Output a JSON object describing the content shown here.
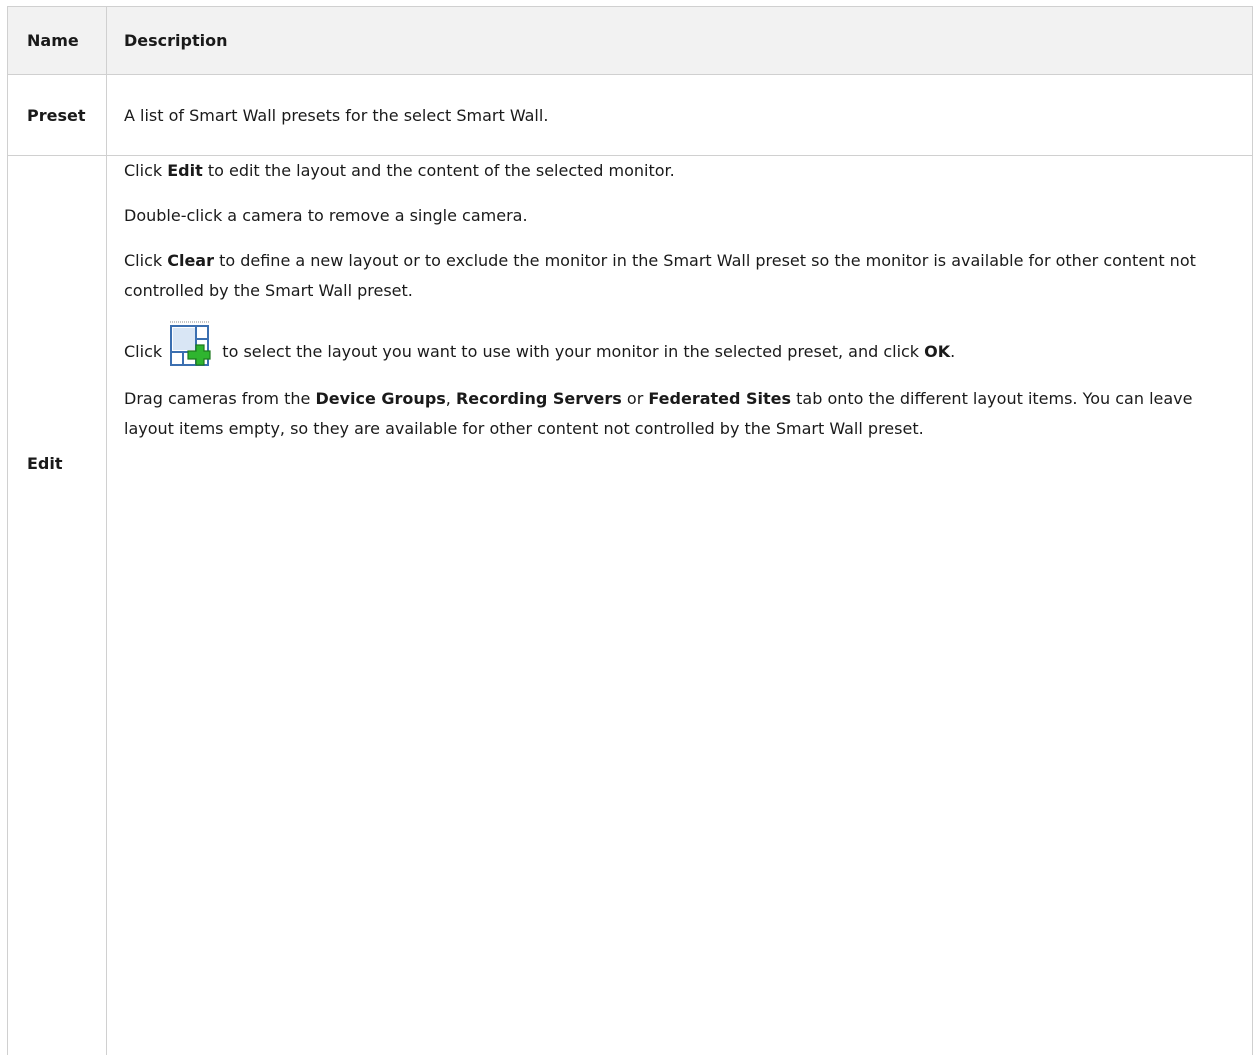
{
  "table": {
    "headers": {
      "name": "Name",
      "description": "Description"
    },
    "rows": {
      "preset": {
        "name": "Preset",
        "description": "A list of Smart Wall presets for the select Smart Wall."
      },
      "edit": {
        "name": "Edit",
        "p1": {
          "a": "Click ",
          "b": "Edit",
          "c": " to edit the layout and the content of the selected monitor."
        },
        "p2": "Double-click a camera to remove a single camera.",
        "p3": {
          "a": "Click ",
          "b": "Clear",
          "c": " to define a new layout or to exclude the monitor in the Smart Wall preset so the monitor is available for other content not controlled by the Smart Wall preset."
        },
        "p4": {
          "a": "Click ",
          "icon": "layout-add-icon",
          "c": " to select the layout you want to use with your monitor in the selected preset, and click ",
          "d": "OK",
          "e": "."
        },
        "p5": {
          "a": "Drag cameras from the ",
          "b": "Device Groups",
          "c": ", ",
          "d": "Recording Servers",
          "e": " or ",
          "f": "Federated Sites",
          "g": " tab onto the different layout items. You can leave layout items empty, so they are available for other content not controlled by the Smart Wall preset."
        }
      }
    }
  },
  "colors": {
    "header_bg": "#f2f2f2",
    "border": "#d0d0d0",
    "icon_green": "#2fb52f",
    "icon_blue": "#3b6fb0"
  }
}
